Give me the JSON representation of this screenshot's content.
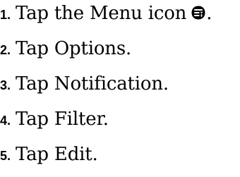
{
  "steps": [
    {
      "number": "1.",
      "text": "Tap the Menu icon",
      "icon": "menu-icon",
      "tail": "."
    },
    {
      "number": "2.",
      "text": "Tap Options."
    },
    {
      "number": "3.",
      "text": "Tap Notification."
    },
    {
      "number": "4.",
      "text": "Tap Filter."
    },
    {
      "number": "5.",
      "text": "Tap Edit."
    }
  ]
}
